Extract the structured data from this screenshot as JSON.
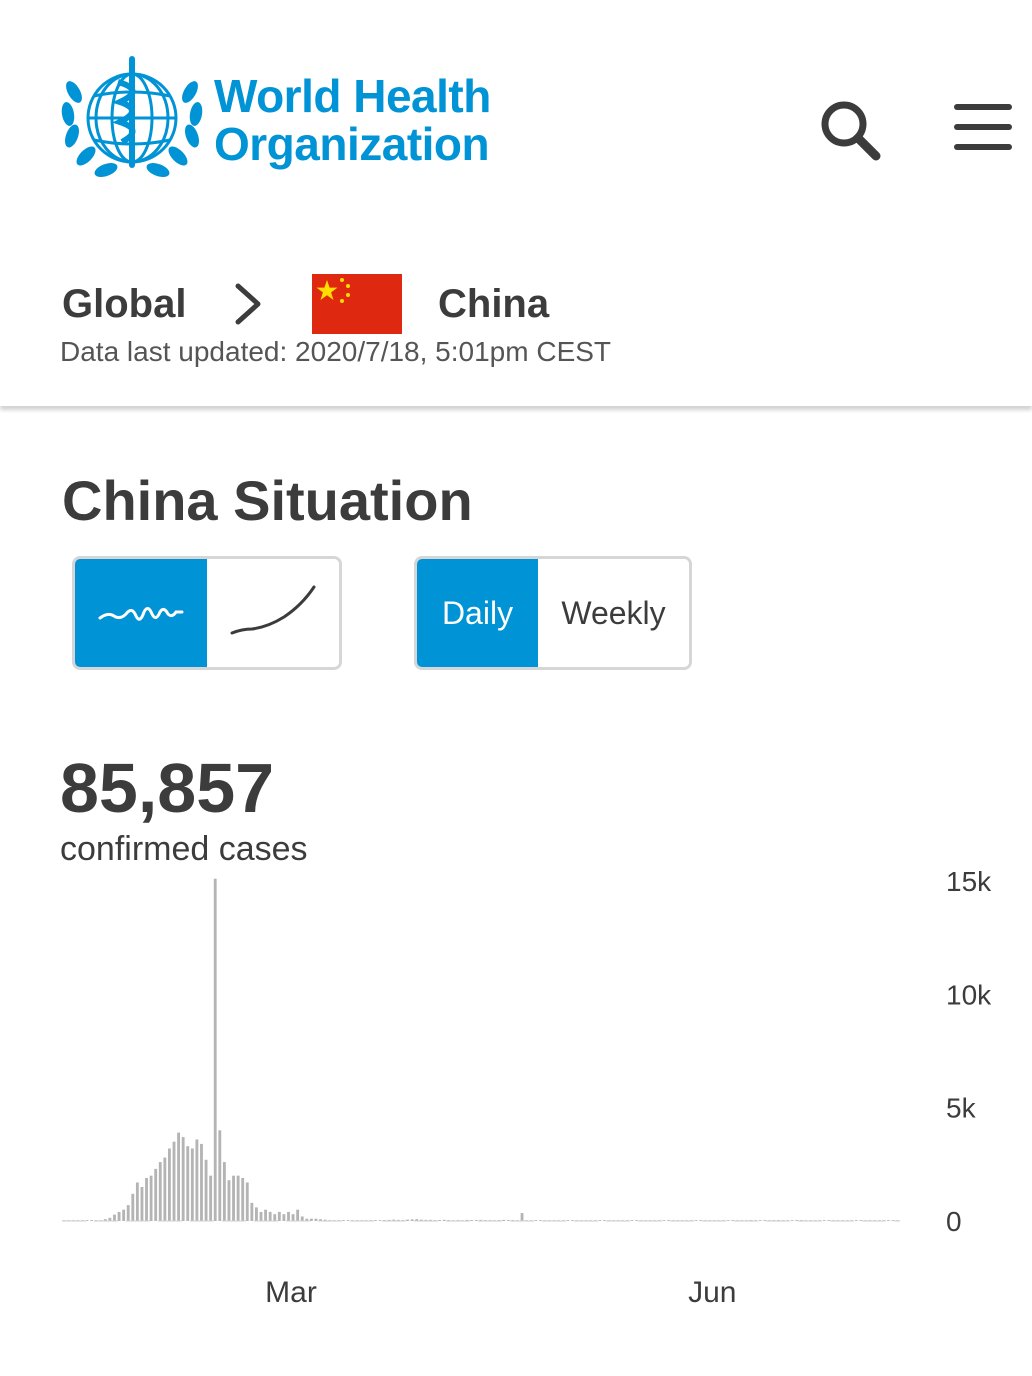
{
  "header": {
    "logo_line1": "World Health",
    "logo_line2": "Organization"
  },
  "breadcrumb": {
    "global": "Global",
    "country": "China",
    "updated": "Data last updated: 2020/7/18, 5:01pm CEST"
  },
  "page_title": "China Situation",
  "toggle_chart": {
    "options": [
      "daily-wave-icon",
      "cumulative-curve-icon"
    ],
    "selected": 0
  },
  "toggle_period": {
    "daily": "Daily",
    "weekly": "Weekly",
    "selected": "Daily"
  },
  "summary": {
    "count": "85,857",
    "label": "confirmed cases"
  },
  "colors": {
    "brand": "#0093d5",
    "bar": "#b4b4b4",
    "flag_red": "#de2910",
    "flag_star": "#ffde00"
  },
  "chart_data": {
    "type": "bar",
    "ylim": [
      0,
      15000
    ],
    "y_ticks": [
      "0",
      "5k",
      "10k",
      "15k"
    ],
    "x_ticks": [
      "Mar",
      "Jun"
    ],
    "y_axis_side": "right",
    "x_start": "2020-01-11",
    "values": [
      0,
      0,
      0,
      0,
      0,
      0,
      0,
      0,
      17,
      80,
      140,
      280,
      400,
      500,
      700,
      1200,
      1700,
      1500,
      1900,
      2000,
      2300,
      2600,
      2800,
      3200,
      3500,
      3900,
      3700,
      3300,
      3200,
      3600,
      3400,
      2700,
      2000,
      15100,
      4000,
      2600,
      1800,
      2000,
      2000,
      1900,
      1700,
      800,
      600,
      400,
      500,
      400,
      300,
      400,
      300,
      400,
      300,
      500,
      200,
      100,
      100,
      100,
      80,
      60,
      40,
      30,
      20,
      20,
      20,
      20,
      20,
      15,
      15,
      15,
      20,
      30,
      40,
      50,
      60,
      50,
      40,
      60,
      70,
      80,
      60,
      50,
      50,
      40,
      40,
      50,
      40,
      30,
      40,
      30,
      50,
      40,
      40,
      50,
      40,
      40,
      30,
      40,
      50,
      40,
      40,
      30,
      350,
      30,
      20,
      20,
      10,
      10,
      20,
      15,
      10,
      10,
      10,
      10,
      10,
      5,
      5,
      5,
      5,
      5,
      5,
      5,
      5,
      5,
      5,
      5,
      5,
      5,
      5,
      5,
      5,
      5,
      5,
      5,
      5,
      5,
      5,
      5,
      5,
      5,
      5,
      5,
      5,
      5,
      5,
      5,
      5,
      5,
      5,
      5,
      20,
      30,
      40,
      30,
      30,
      20,
      30,
      40,
      40,
      30,
      30,
      30,
      40,
      40,
      20,
      20,
      20,
      10,
      20,
      20,
      20,
      20,
      10,
      10,
      10,
      20,
      20,
      10,
      10,
      10,
      10,
      10,
      20,
      20,
      10
    ]
  }
}
